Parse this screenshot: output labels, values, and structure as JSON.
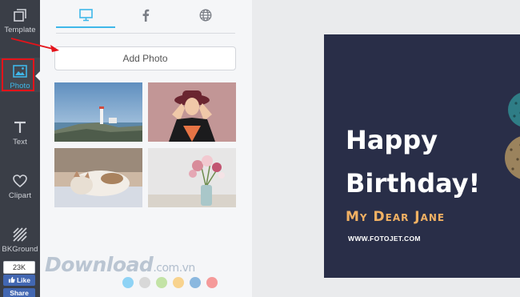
{
  "rail": {
    "items": [
      {
        "label": "Template",
        "icon": "template-icon"
      },
      {
        "label": "Photo",
        "icon": "photo-icon",
        "active": true
      },
      {
        "label": "Text",
        "icon": "text-icon"
      },
      {
        "label": "Clipart",
        "icon": "heart-icon"
      },
      {
        "label": "BKGround",
        "icon": "background-stripes-icon"
      }
    ],
    "like_count": "23K",
    "like_label": "Like",
    "share_label": "Share"
  },
  "panel": {
    "tabs": [
      {
        "name": "computer",
        "icon": "monitor-icon",
        "active": true
      },
      {
        "name": "facebook",
        "icon": "facebook-icon"
      },
      {
        "name": "web",
        "icon": "globe-icon"
      }
    ],
    "add_photo_label": "Add Photo",
    "photos": [
      {
        "subject": "lighthouse on rocky coast"
      },
      {
        "subject": "woman in hat"
      },
      {
        "subject": "sleeping cat"
      },
      {
        "subject": "flowers in vase"
      }
    ],
    "swatches": [
      "#8fd3f5",
      "#d8d8d8",
      "#c3e3a6",
      "#f8d38e",
      "#8bb8df",
      "#f59a9a"
    ]
  },
  "watermark": {
    "main": "Download",
    "tld": ".com.vn"
  },
  "card": {
    "line1": "Happy",
    "line2": "Birthday!",
    "subtitle": "My Dear Jane",
    "url": "WWW.FOTOJET.COM",
    "bg_color": "#292e48",
    "accent_color": "#f2b163"
  },
  "colors": {
    "accent": "#3fb7e9",
    "highlight": "#e4131a"
  }
}
